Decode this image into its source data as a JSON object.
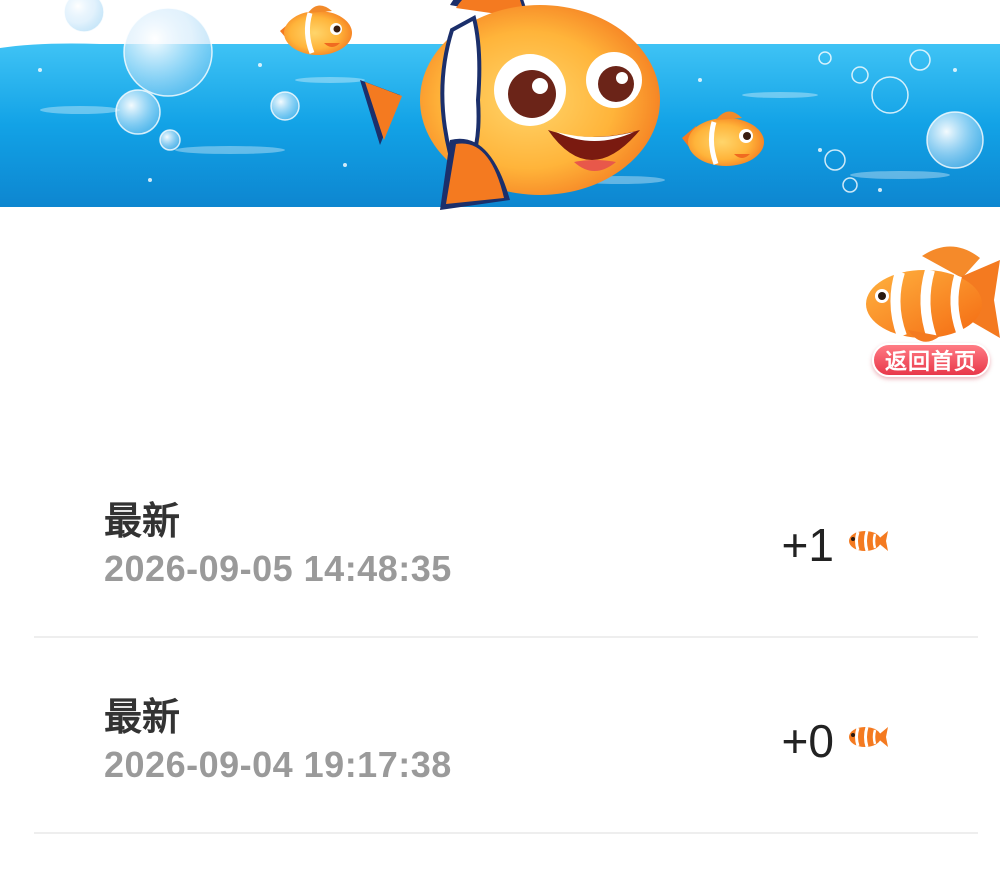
{
  "header": {
    "banner_image": "clownfish-ocean-banner"
  },
  "home_button": {
    "label": "返回首页",
    "icon": "clownfish-icon"
  },
  "records": [
    {
      "title": "最新",
      "time": "2026-09-05 14:48:35",
      "amount": "+1",
      "icon": "clownfish-icon"
    },
    {
      "title": "最新",
      "time": "2026-09-04 19:17:38",
      "amount": "+0",
      "icon": "clownfish-icon"
    }
  ],
  "colors": {
    "ocean_blue": "#1aa3e8",
    "fish_orange": "#f47a20",
    "pill_red": "#e8384a",
    "divider": "#eeeeee",
    "title_text": "#333333",
    "time_text": "#9a9a9a"
  }
}
